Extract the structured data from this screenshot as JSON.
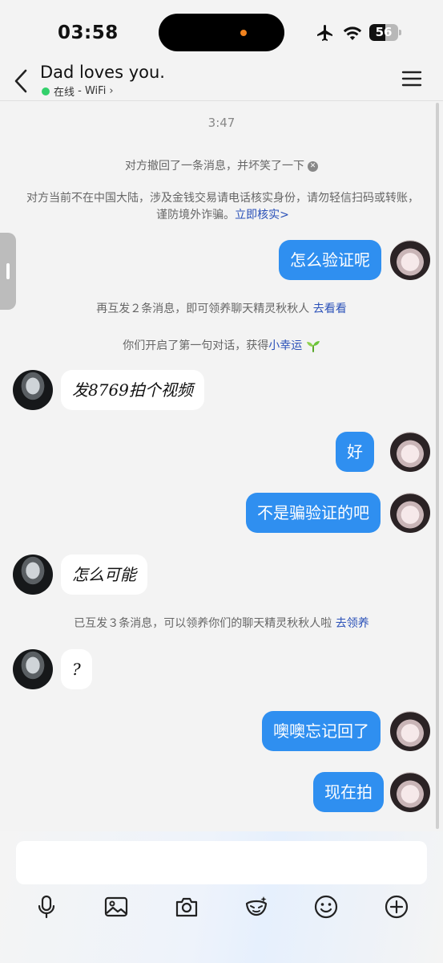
{
  "status": {
    "time": "03:58",
    "battery": "56",
    "battery_level": 0.56
  },
  "header": {
    "title": "Dad loves you.",
    "presence_status": "在线",
    "presence_network": "WiFi",
    "presence_separator": " - "
  },
  "system": {
    "timestamp": "3:47",
    "recall_notice": "对方撤回了一条消息，并坏笑了一下",
    "warning_text": "对方当前不在中国大陆，涉及金钱交易请电话核实身份，请勿轻信扫码或转账，谨防境外诈骗。",
    "warning_link": "立即核实>",
    "reward1_text": "再互发２条消息，即可领养聊天精灵秋秋人 ",
    "reward1_link": "去看看",
    "reward2_text": "你们开启了第一句对话，获得",
    "reward2_link": "小幸运",
    "reward3_text": "已互发３条消息，可以领养你们的聊天精灵秋秋人啦 ",
    "reward3_link": "去领养"
  },
  "messages": [
    {
      "sender": "me",
      "text": "怎么验证呢"
    },
    {
      "sender": "them",
      "text": "发8769拍个视频"
    },
    {
      "sender": "me",
      "text": "好"
    },
    {
      "sender": "me",
      "text": "不是骗验证的吧"
    },
    {
      "sender": "them",
      "text": "怎么可能"
    },
    {
      "sender": "them",
      "text": "?"
    },
    {
      "sender": "me",
      "text": "噢噢忘记回了"
    },
    {
      "sender": "me",
      "text": "现在拍"
    }
  ],
  "composer": {
    "tools": [
      "microphone-icon",
      "image-icon",
      "camera-icon",
      "mask-sticker-icon",
      "emoji-icon",
      "plus-icon"
    ]
  },
  "colors": {
    "my_bubble": "#2f8ff0",
    "their_bubble": "#ffffff",
    "link": "#2a50b8",
    "online": "#33d06b"
  }
}
